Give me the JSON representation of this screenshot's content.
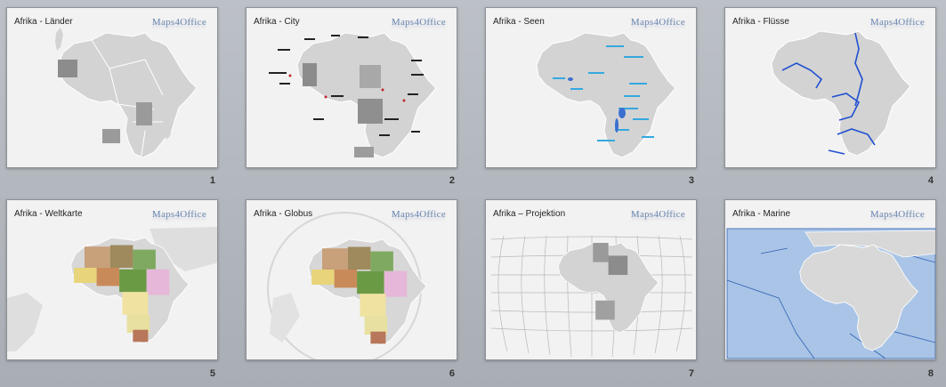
{
  "logo_text": "Maps4Office",
  "slides": [
    {
      "title": "Afrika - Länder",
      "number": "1"
    },
    {
      "title": "Afrika - City",
      "number": "2"
    },
    {
      "title": "Afrika - Seen",
      "number": "3"
    },
    {
      "title": "Afrika - Flüsse",
      "number": "4"
    },
    {
      "title": "Afrika - Weltkarte",
      "number": "5"
    },
    {
      "title": "Afrika - Globus",
      "number": "6"
    },
    {
      "title": "Afrika – Projektion",
      "number": "7"
    },
    {
      "title": "Afrika - Marine",
      "number": "8"
    }
  ],
  "colors": {
    "land": "#d3d3d3",
    "land_dark": "#9c9c9c",
    "river_blue": "#1f4fd1",
    "lake_blue": "#35a8e0",
    "ocean_marine": "#a9c4e6",
    "marine_line": "#2f5fb3",
    "logo": "#6b86b0"
  }
}
